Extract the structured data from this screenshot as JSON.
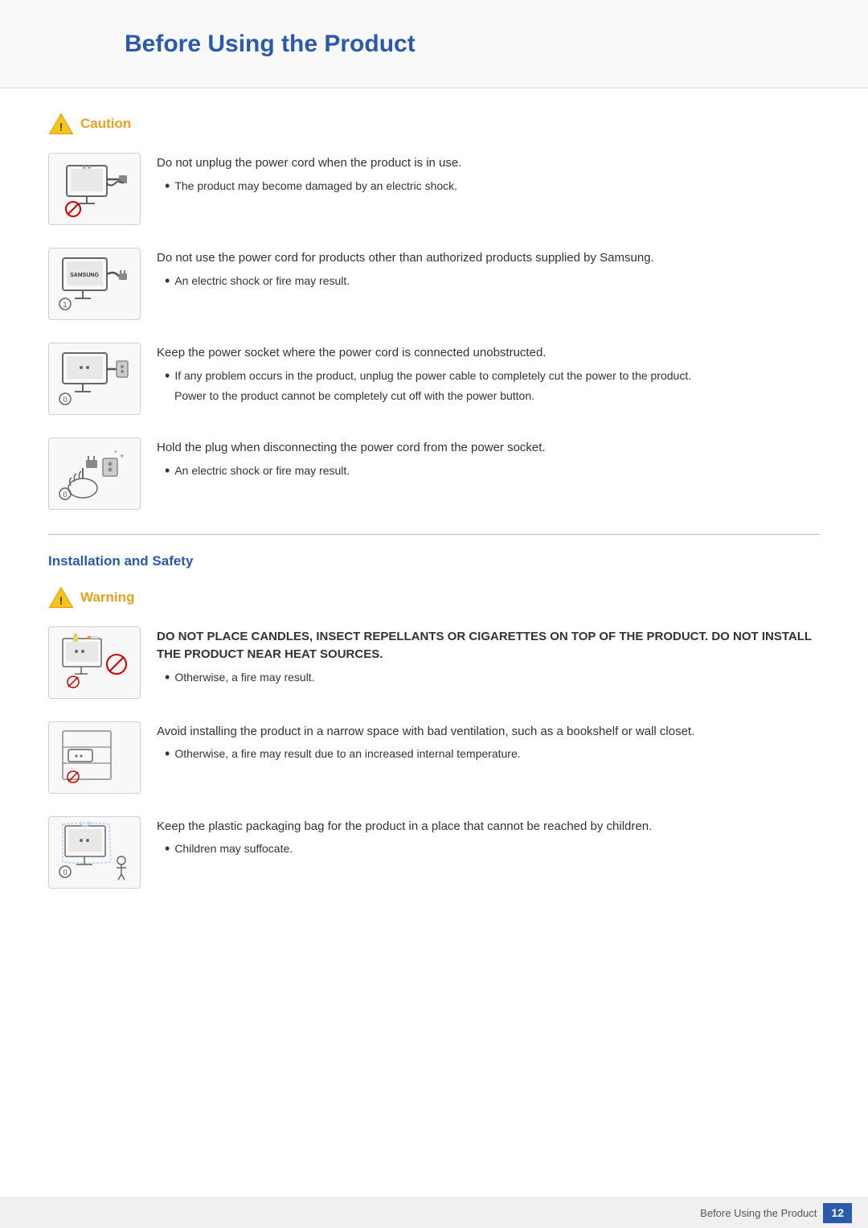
{
  "page": {
    "title": "Before Using the Product",
    "footer_text": "Before Using the Product",
    "page_number": "12"
  },
  "caution_section": {
    "label": "Caution",
    "items": [
      {
        "id": "item1",
        "main_text": "Do not unplug the power cord when the product is in use.",
        "bullets": [
          "The product may become damaged by an electric shock."
        ],
        "notes": []
      },
      {
        "id": "item2",
        "main_text": "Do not use the power cord for products other than authorized products supplied by Samsung.",
        "bullets": [
          "An electric shock or fire may result."
        ],
        "notes": []
      },
      {
        "id": "item3",
        "main_text": "Keep the power socket where the power cord is connected unobstructed.",
        "bullets": [
          "If any problem occurs in the product, unplug the power cable to completely cut the power to the product."
        ],
        "notes": [
          "Power to the product cannot be completely cut off with the power button."
        ]
      },
      {
        "id": "item4",
        "main_text": "Hold the plug when disconnecting the power cord from the power socket.",
        "bullets": [
          "An electric shock or fire may result."
        ],
        "notes": []
      }
    ]
  },
  "installation_section": {
    "label": "Installation and Safety",
    "warning_label": "Warning",
    "items": [
      {
        "id": "warn1",
        "main_text": "DO NOT PLACE CANDLES, INSECT REPELLANTS OR CIGARETTES ON TOP OF THE PRODUCT. DO NOT INSTALL THE PRODUCT NEAR HEAT SOURCES.",
        "bullets": [
          "Otherwise, a fire may result."
        ],
        "notes": []
      },
      {
        "id": "warn2",
        "main_text": "Avoid installing the product in a narrow space with bad ventilation, such as a bookshelf or wall closet.",
        "bullets": [
          "Otherwise, a fire may result due to an increased internal temperature."
        ],
        "notes": []
      },
      {
        "id": "warn3",
        "main_text": "Keep the plastic packaging bag for the product in a place that cannot be reached by children.",
        "bullets": [
          "Children may suffocate."
        ],
        "notes": []
      }
    ]
  }
}
